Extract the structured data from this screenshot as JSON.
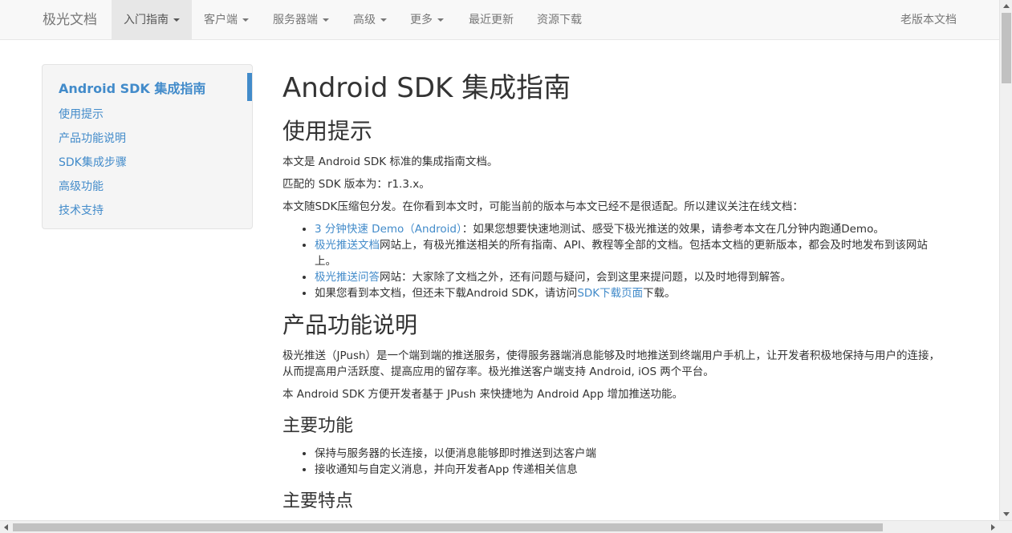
{
  "navbar": {
    "brand": "极光文档",
    "items": [
      {
        "label": "入门指南",
        "dropdown": true,
        "active": true
      },
      {
        "label": "客户端",
        "dropdown": true
      },
      {
        "label": "服务器端",
        "dropdown": true
      },
      {
        "label": "高级",
        "dropdown": true
      },
      {
        "label": "更多",
        "dropdown": true
      },
      {
        "label": "最近更新",
        "dropdown": false
      },
      {
        "label": "资源下载",
        "dropdown": false
      }
    ],
    "right_link": "老版本文档"
  },
  "sidebar": {
    "title": "Android SDK 集成指南",
    "links": [
      "使用提示",
      "产品功能说明",
      "SDK集成步骤",
      "高级功能",
      "技术支持"
    ]
  },
  "content": {
    "h1": "Android SDK 集成指南",
    "section1": {
      "heading": "使用提示",
      "p1": "本文是 Android SDK 标准的集成指南文档。",
      "p2": "匹配的 SDK 版本为：r1.3.x。",
      "p3": "本文随SDK压缩包分发。在你看到本文时，可能当前的版本与本文已经不是很适配。所以建议关注在线文档：",
      "bullets": [
        {
          "link": "3 分钟快速 Demo（Android）",
          "text": "：如果您想要快速地测试、感受下极光推送的效果，请参考本文在几分钟内跑通Demo。"
        },
        {
          "link": "极光推送文档",
          "text": "网站上，有极光推送相关的所有指南、API、教程等全部的文档。包括本文档的更新版本，都会及时地发布到该网站上。"
        },
        {
          "link": "极光推送问答",
          "text": "网站：大家除了文档之外，还有问题与疑问，会到这里来提问题，以及时地得到解答。"
        },
        {
          "pre": "如果您看到本文档，但还未下载Android SDK，请访问",
          "link": "SDK下载页面",
          "text": "下载。"
        }
      ]
    },
    "section2": {
      "heading": "产品功能说明",
      "p1": "极光推送（JPush）是一个端到端的推送服务，使得服务器端消息能够及时地推送到终端用户手机上，让开发者积极地保持与用户的连接，从而提高用户活跃度、提高应用的留存率。极光推送客户端支持 Android, iOS 两个平台。",
      "p2": "本 Android SDK 方便开发者基于 JPush 来快捷地为 Android App 增加推送功能。",
      "sub1": {
        "heading": "主要功能",
        "bullets": [
          "保持与服务器的长连接，以便消息能够即时推送到达客户端",
          "接收通知与自定义消息，并向开发者App 传递相关信息"
        ]
      },
      "sub2": {
        "heading": "主要特点"
      }
    }
  },
  "colors": {
    "link": "#428bca",
    "navbar_bg": "#f8f8f8",
    "sidebar_bg": "#f5f5f5"
  }
}
